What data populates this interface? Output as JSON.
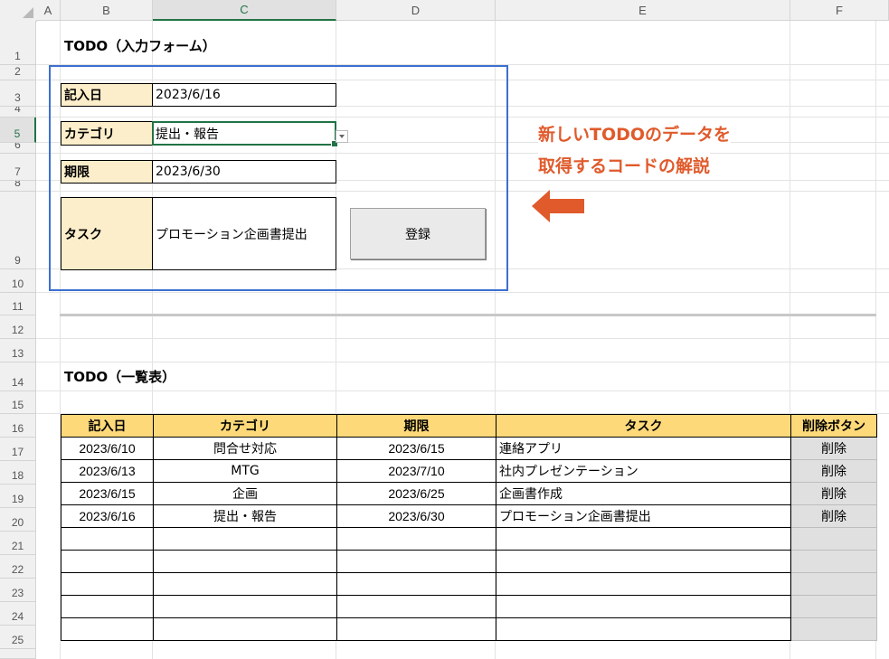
{
  "columns": [
    "A",
    "B",
    "C",
    "D",
    "E",
    "F"
  ],
  "rows": [
    "1",
    "2",
    "3",
    "4",
    "5",
    "6",
    "7",
    "8",
    "9",
    "10",
    "11",
    "12",
    "13",
    "14",
    "15",
    "16",
    "17",
    "18",
    "19",
    "20",
    "21",
    "22",
    "23",
    "24",
    "25"
  ],
  "form": {
    "title": "TODO（入力フォーム）",
    "date_label": "記入日",
    "date_value": "2023/6/16",
    "category_label": "カテゴリ",
    "category_value": "提出・報告",
    "deadline_label": "期限",
    "deadline_value": "2023/6/30",
    "task_label": "タスク",
    "task_value": "プロモーション企画書提出",
    "register_button": "登録"
  },
  "annotation": {
    "line1": "新しいTODOのデータを",
    "line2": "取得するコードの解説",
    "color": "#e05a2b"
  },
  "list": {
    "title": "TODO（一覧表）",
    "headers": [
      "記入日",
      "カテゴリ",
      "期限",
      "タスク",
      "削除ボタン"
    ],
    "rows": [
      {
        "date": "2023/6/10",
        "category": "問合せ対応",
        "deadline": "2023/6/15",
        "task": "連絡アプリ",
        "delete": "削除"
      },
      {
        "date": "2023/6/13",
        "category": "MTG",
        "deadline": "2023/7/10",
        "task": "社内プレゼンテーション",
        "delete": "削除"
      },
      {
        "date": "2023/6/15",
        "category": "企画",
        "deadline": "2023/6/25",
        "task": "企画書作成",
        "delete": "削除"
      },
      {
        "date": "2023/6/16",
        "category": "提出・報告",
        "deadline": "2023/6/30",
        "task": "プロモーション企画書提出",
        "delete": "削除"
      }
    ],
    "empty_rows": 5
  },
  "colors": {
    "accent": "#217346",
    "label_fill": "#fdeecb",
    "header_fill": "#fdd97a",
    "frame": "#3c6fd1"
  }
}
